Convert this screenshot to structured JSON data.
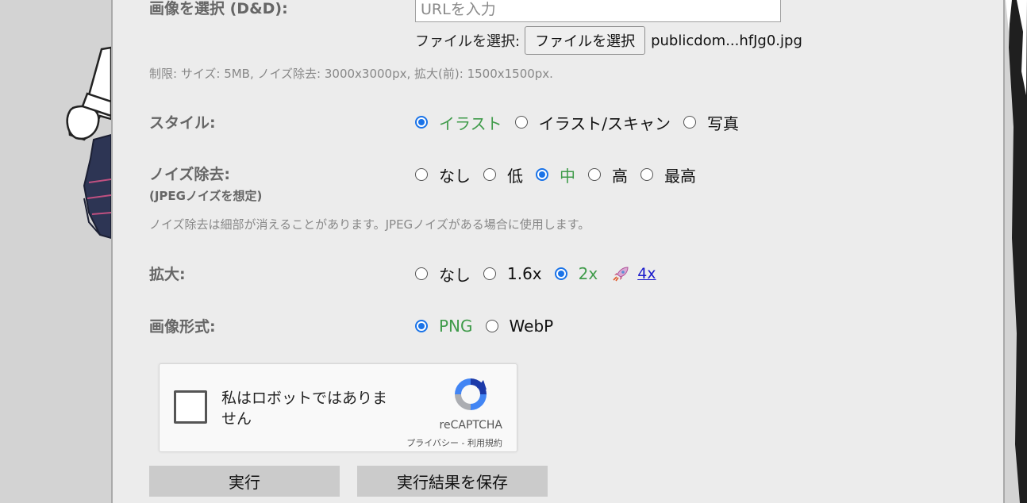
{
  "form": {
    "image_select": {
      "label": "画像を選択 (D&D):",
      "url_placeholder": "URLを入力",
      "file_label": "ファイルを選択:",
      "file_button": "ファイルを選択",
      "file_name": "publicdom...hfJg0.jpg",
      "limits_note": "制限: サイズ: 5MB, ノイズ除去: 3000x3000px, 拡大(前): 1500x1500px."
    },
    "style": {
      "label": "スタイル:",
      "options": [
        {
          "label": "イラスト",
          "selected": true
        },
        {
          "label": "イラスト/スキャン",
          "selected": false
        },
        {
          "label": "写真",
          "selected": false
        }
      ]
    },
    "noise": {
      "label": "ノイズ除去:",
      "sublabel": "(JPEGノイズを想定)",
      "options": [
        {
          "label": "なし",
          "selected": false
        },
        {
          "label": "低",
          "selected": false
        },
        {
          "label": "中",
          "selected": true
        },
        {
          "label": "高",
          "selected": false
        },
        {
          "label": "最高",
          "selected": false
        }
      ],
      "note": "ノイズ除去は細部が消えることがあります。JPEGノイズがある場合に使用します。"
    },
    "scale": {
      "label": "拡大:",
      "options": [
        {
          "label": "なし",
          "selected": false
        },
        {
          "label": "1.6x",
          "selected": false
        },
        {
          "label": "2x",
          "selected": true
        }
      ],
      "link_label": "4x",
      "link_icon": "rocket-icon"
    },
    "format": {
      "label": "画像形式:",
      "options": [
        {
          "label": "PNG",
          "selected": true
        },
        {
          "label": "WebP",
          "selected": false
        }
      ]
    }
  },
  "captcha": {
    "text": "私はロボットではありません",
    "brand": "reCAPTCHA",
    "links": "プライバシー - 利用規約"
  },
  "actions": {
    "run": "実行",
    "save": "実行結果を保存"
  },
  "colors": {
    "selected_option": "#3f9b4a",
    "radio_accent": "#1a73e8",
    "link": "#1a1acc",
    "panel_bg": "#ececec",
    "button_bg": "#cbcbcb"
  }
}
